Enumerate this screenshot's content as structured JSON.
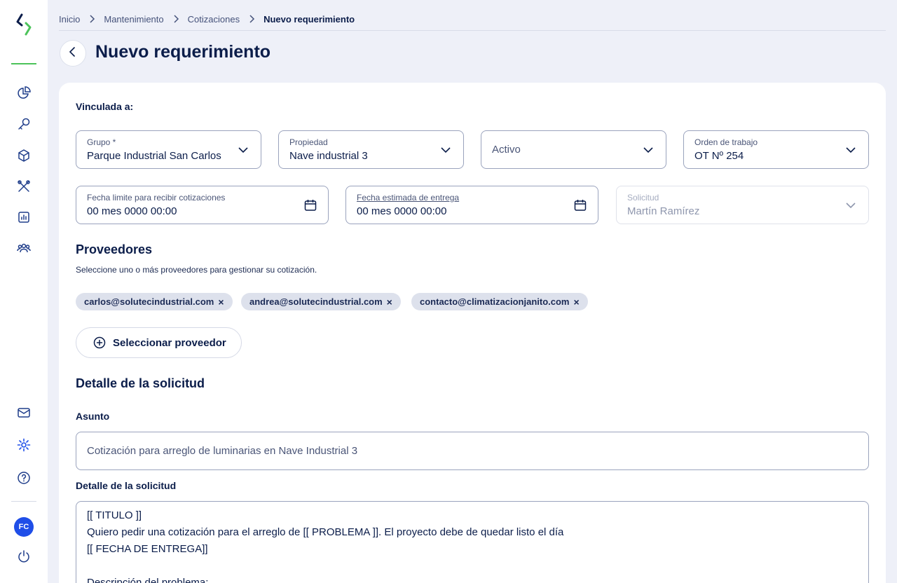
{
  "sidebar": {
    "avatar_initials": "FC",
    "nav_icons": [
      "dashboard-icon",
      "key-icon",
      "box-icon",
      "tools-icon",
      "report-icon",
      "team-icon"
    ],
    "bottom_icons": [
      "mail-icon",
      "gear-icon",
      "help-icon"
    ],
    "accent_color": "#4cc35a",
    "avatar_color": "#1f4ee8"
  },
  "breadcrumb": {
    "items": [
      "Inicio",
      "Mantenimiento",
      "Cotizaciones"
    ],
    "current": "Nuevo requerimiento"
  },
  "page": {
    "title": "Nuevo requerimiento"
  },
  "form": {
    "linked_label": "Vinculada a:",
    "grupo": {
      "label": "Grupo *",
      "value": "Parque Industrial San Carlos"
    },
    "propiedad": {
      "label": "Propiedad",
      "value": "Nave industrial 3"
    },
    "activo": {
      "placeholder": "Activo"
    },
    "orden": {
      "label": "Orden de trabajo",
      "value": "OT Nº 254"
    },
    "fecha_limite": {
      "label": "Fecha limite para recibir cotizaciones",
      "value": "00 mes 0000 00:00"
    },
    "fecha_entrega": {
      "label": "Fecha estimada de entrega",
      "value": "00 mes 0000 00:00"
    },
    "solicitud": {
      "label": "Solicitud",
      "value": "Martín Ramírez"
    }
  },
  "proveedores": {
    "title": "Proveedores",
    "help": "Seleccione uno o más proveedores para gestionar su cotización.",
    "chips": [
      "carlos@solutecindustrial.com",
      "andrea@solutecindustrial.com",
      "contacto@climatizacionjanito.com"
    ],
    "chip_remove": "×",
    "select_button": "Seleccionar proveedor"
  },
  "detalle": {
    "title": "Detalle de la solicitud",
    "asunto_label": "Asunto",
    "asunto_value": "Cotización para arreglo de luminarias en Nave Industrial 3",
    "detalle_label": "Detalle de la solicitud",
    "detalle_value": "[[ TITULO ]]\nQuiero pedir una cotización para el arreglo de [[ PROBLEMA ]]. El proyecto debe de quedar listo el día\n[[ FECHA DE ENTREGA]]\n\nDescripción del problema:"
  }
}
